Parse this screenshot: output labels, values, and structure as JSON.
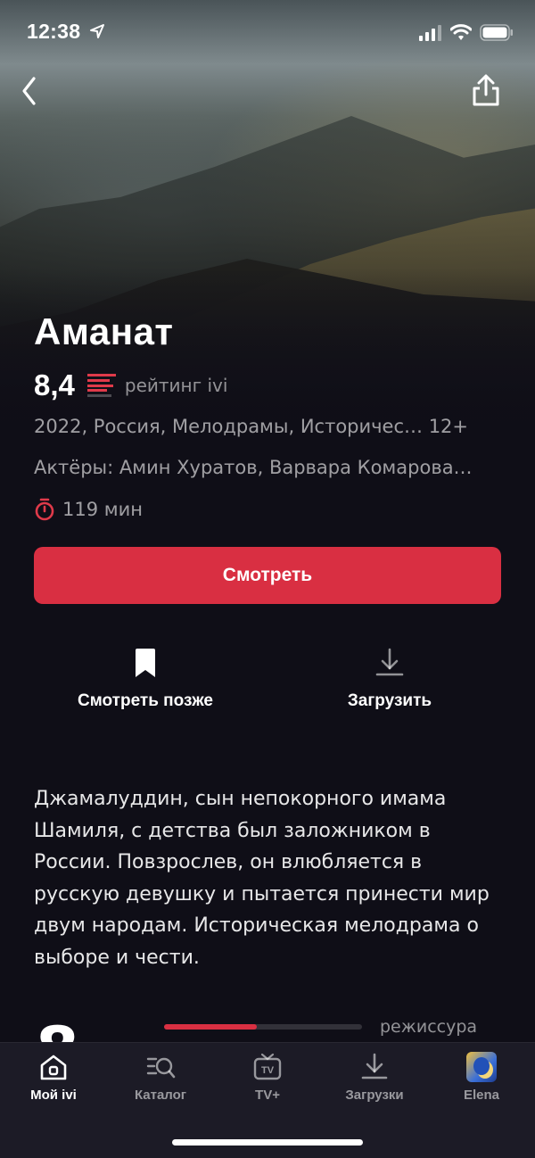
{
  "status_bar": {
    "time": "12:38",
    "icons": [
      "location-arrow-icon",
      "signal-icon",
      "wifi-icon",
      "battery-icon"
    ]
  },
  "header": {
    "back_icon": "chevron-left-icon",
    "share_icon": "share-icon"
  },
  "movie": {
    "title": "Аманат",
    "rating": "8,4",
    "rating_label": "рейтинг ivi",
    "meta": "2022, Россия, Мелодрамы, Историчес… 12+",
    "actors": "Актёры: Амин Хуратов, Варвара Комарова…",
    "duration": "119 мин",
    "description": "Джамалуддин, сын непокорного имама Шамиля, с детства был заложником в России. Повзрослев, он влюбляется в русскую девушку и пытается принести мир двум народам. Историческая мелодрама о выборе и чести."
  },
  "actions": {
    "watch_label": "Смотреть",
    "watch_later_label": "Смотреть позже",
    "download_label": "Загрузить"
  },
  "rating_detail": {
    "score_digit": "8",
    "bar_fraction": 0.47,
    "label": "режиссура"
  },
  "tab_bar": {
    "active": "Мой ivi",
    "items": [
      {
        "label": "Мой ivi",
        "icon": "home-icon"
      },
      {
        "label": "Каталог",
        "icon": "catalog-search-icon"
      },
      {
        "label": "TV+",
        "icon": "tv-icon"
      },
      {
        "label": "Загрузки",
        "icon": "download-icon"
      },
      {
        "label": "Elena",
        "icon": "avatar"
      }
    ]
  },
  "colors": {
    "accent": "#d92f42",
    "background": "#0f0e17",
    "tab_bar": "#1c1b26"
  }
}
